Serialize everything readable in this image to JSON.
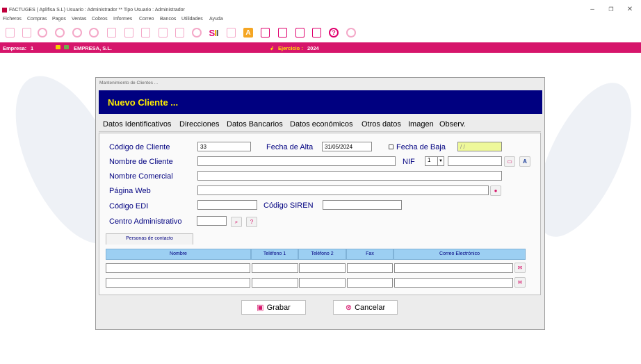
{
  "window": {
    "title": "FACTUGES  ( Aplifisa S.L)   Usuario : Administrador  **  Tipo Usuario : Administrador"
  },
  "menu": [
    "Ficheros",
    "Compras",
    "Pagos",
    "Ventas",
    "Cobros",
    "Informes",
    "Correo",
    "Bancos",
    "Utilidades",
    "Ayuda"
  ],
  "toolbar": {
    "sii_label": "SII",
    "a_label": "A",
    "help_label": "?"
  },
  "status": {
    "empresa_label": "Empresa:",
    "empresa_num": "1",
    "empresa_name": "EMPRESA, S.L.",
    "ejercicio_label": "Ejercicio :",
    "ejercicio_value": "2024"
  },
  "dialog": {
    "caption": "Mantenimiento de Clientes ...",
    "header": "Nuevo Cliente ...",
    "tabs": [
      "Datos Identificativos",
      "Direcciones",
      "Datos Bancarios",
      "Datos económicos",
      "Otros datos",
      "Imagen",
      "Observ."
    ],
    "fields": {
      "codigo_label": "Código de Cliente",
      "codigo_value": "33",
      "fecha_alta_label": "Fecha de Alta",
      "fecha_alta_value": "31/05/2024",
      "fecha_baja_label": "Fecha de Baja",
      "fecha_baja_value": "/ /",
      "nombre_label": "Nombre de Cliente",
      "nif_label": "NIF",
      "nif_type": "1",
      "nombre_comercial_label": "Nombre Comercial",
      "web_label": "Página Web",
      "edi_label": "Código EDI",
      "siren_label": "Código SIREN",
      "centro_label": "Centro Administrativo"
    },
    "contacts": {
      "tab_label": "Personas de contacto",
      "columns": [
        "Nombre",
        "Teléfono 1",
        "Teléfono 2",
        "Fax",
        "Correo Electrónico"
      ],
      "rows": [
        [
          "",
          "",
          "",
          "",
          ""
        ],
        [
          "",
          "",
          "",
          "",
          ""
        ]
      ]
    },
    "buttons": {
      "save": "Grabar",
      "cancel": "Cancelar"
    }
  },
  "colors": {
    "accent": "#d6156b",
    "header_bg": "#000080",
    "header_text": "#ffee00",
    "label": "#000080",
    "grid_header": "#9ccff2"
  }
}
